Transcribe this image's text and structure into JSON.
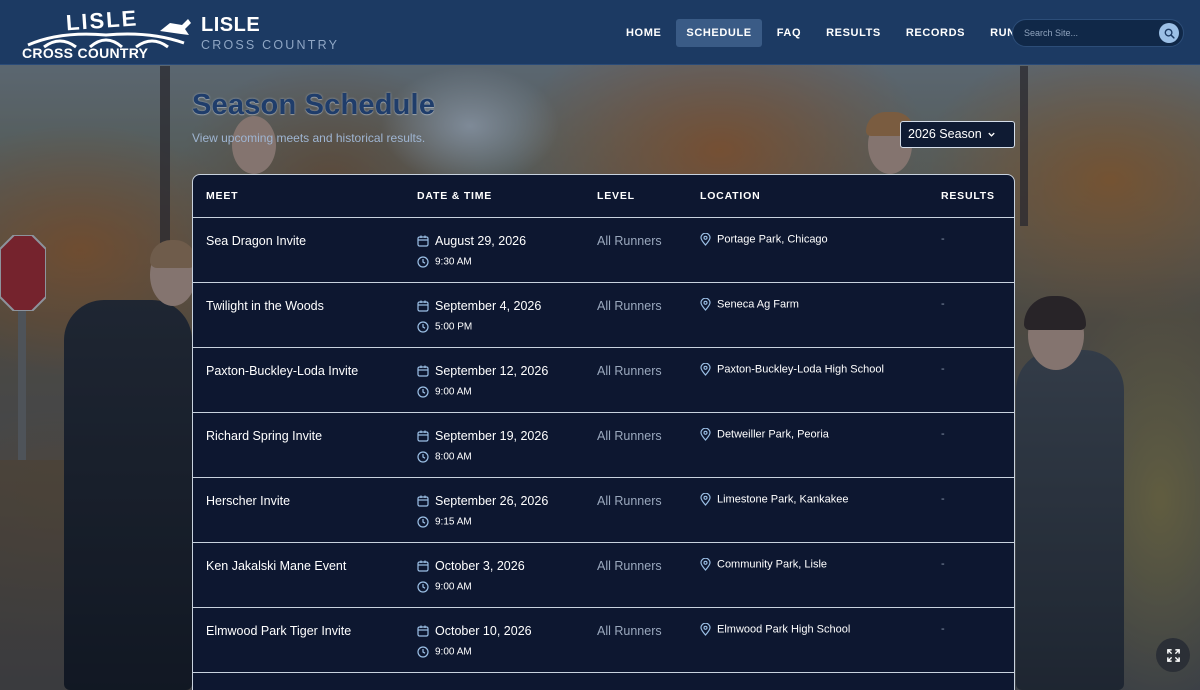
{
  "header": {
    "logo_text_top": "LISLE",
    "logo_text_bottom": "CROSS COUNTRY",
    "brand_title": "LISLE",
    "brand_subtitle": "CROSS COUNTRY",
    "nav": [
      {
        "label": "HOME"
      },
      {
        "label": "SCHEDULE",
        "active": true
      },
      {
        "label": "FAQ"
      },
      {
        "label": "RESULTS"
      },
      {
        "label": "RECORDS"
      },
      {
        "label": "RUNNERS"
      }
    ],
    "search": {
      "placeholder": "Search Site...",
      "value": "",
      "icon": "search-icon"
    }
  },
  "hero": {
    "title": "Season Schedule",
    "subtitle": "View upcoming meets and historical results.",
    "season_selected": "2026 Season"
  },
  "table": {
    "headers": {
      "meet": "MEET",
      "date": "DATE & TIME",
      "level": "LEVEL",
      "location": "LOCATION",
      "results": "RESULTS"
    },
    "rows": [
      {
        "meet": "Sea Dragon Invite",
        "date": "August 29, 2026",
        "time": "9:30 AM",
        "level": "All Runners",
        "location": "Portage Park, Chicago",
        "results": "-"
      },
      {
        "meet": "Twilight in the Woods",
        "date": "September 4, 2026",
        "time": "5:00 PM",
        "level": "All Runners",
        "location": "Seneca Ag Farm",
        "results": "-"
      },
      {
        "meet": "Paxton-Buckley-Loda Invite",
        "date": "September 12, 2026",
        "time": "9:00 AM",
        "level": "All Runners",
        "location": "Paxton-Buckley-Loda High School",
        "results": "-"
      },
      {
        "meet": "Richard Spring Invite",
        "date": "September 19, 2026",
        "time": "8:00 AM",
        "level": "All Runners",
        "location": "Detweiller Park, Peoria",
        "results": "-"
      },
      {
        "meet": "Herscher Invite",
        "date": "September 26, 2026",
        "time": "9:15 AM",
        "level": "All Runners",
        "location": "Limestone Park, Kankakee",
        "results": "-"
      },
      {
        "meet": "Ken Jakalski Mane Event",
        "date": "October 3, 2026",
        "time": "9:00 AM",
        "level": "All Runners",
        "location": "Community Park, Lisle",
        "results": "-"
      },
      {
        "meet": "Elmwood Park Tiger Invite",
        "date": "October 10, 2026",
        "time": "9:00 AM",
        "level": "All Runners",
        "location": "Elmwood Park High School",
        "results": "-"
      }
    ]
  },
  "icons": {
    "calendar": "calendar-icon",
    "clock": "clock-icon",
    "location": "map-pin-icon",
    "chevron": "chevron-down-icon",
    "expand": "expand-icon"
  },
  "colors": {
    "header_bg": "#1c3a63",
    "nav_active_bg": "#3a5b86",
    "table_bg": "#0d1730",
    "title": "#1f3d6b",
    "accent": "#9cc0e6"
  }
}
